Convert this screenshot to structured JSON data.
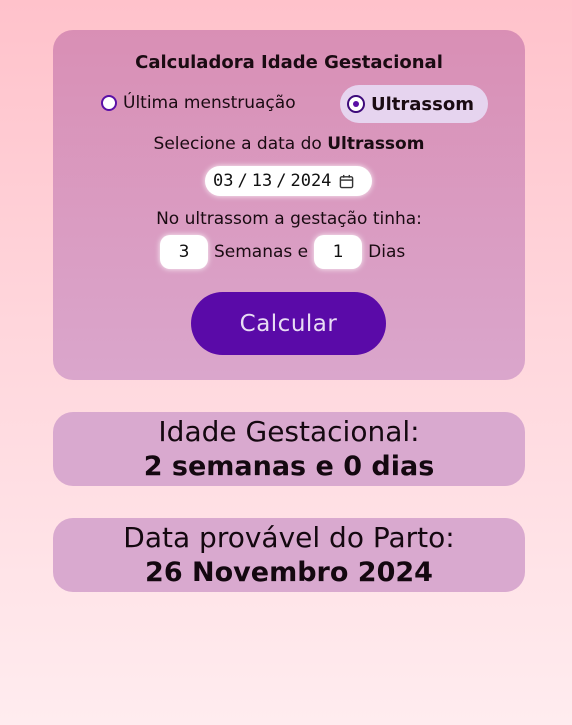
{
  "calculator": {
    "title": "Calculadora Idade Gestacional",
    "method_options": [
      {
        "label": "Última menstruação",
        "selected": false
      },
      {
        "label": "Ultrassom",
        "selected": true
      }
    ],
    "date_prompt_prefix": "Selecione a data do ",
    "date_prompt_method": "Ultrassom",
    "date_input": {
      "month": "03",
      "day": "13",
      "year": "2024",
      "separator": "/",
      "icon": "calendar-icon"
    },
    "gestation_prompt": "No ultrassom a gestação tinha:",
    "weeks_value": "3",
    "weeks_label": "Semanas e",
    "days_value": "1",
    "days_label": "Dias",
    "calculate_label": "Calcular"
  },
  "results": {
    "age_label": "Idade Gestacional:",
    "age_value": "2 semanas e 0 dias",
    "due_label": "Data provável do Parto:",
    "due_value": "26 Novembro 2024"
  },
  "colors": {
    "accent": "#5a0aa8",
    "card": "#d9a9cf",
    "background_top": "#ffc2cb"
  }
}
